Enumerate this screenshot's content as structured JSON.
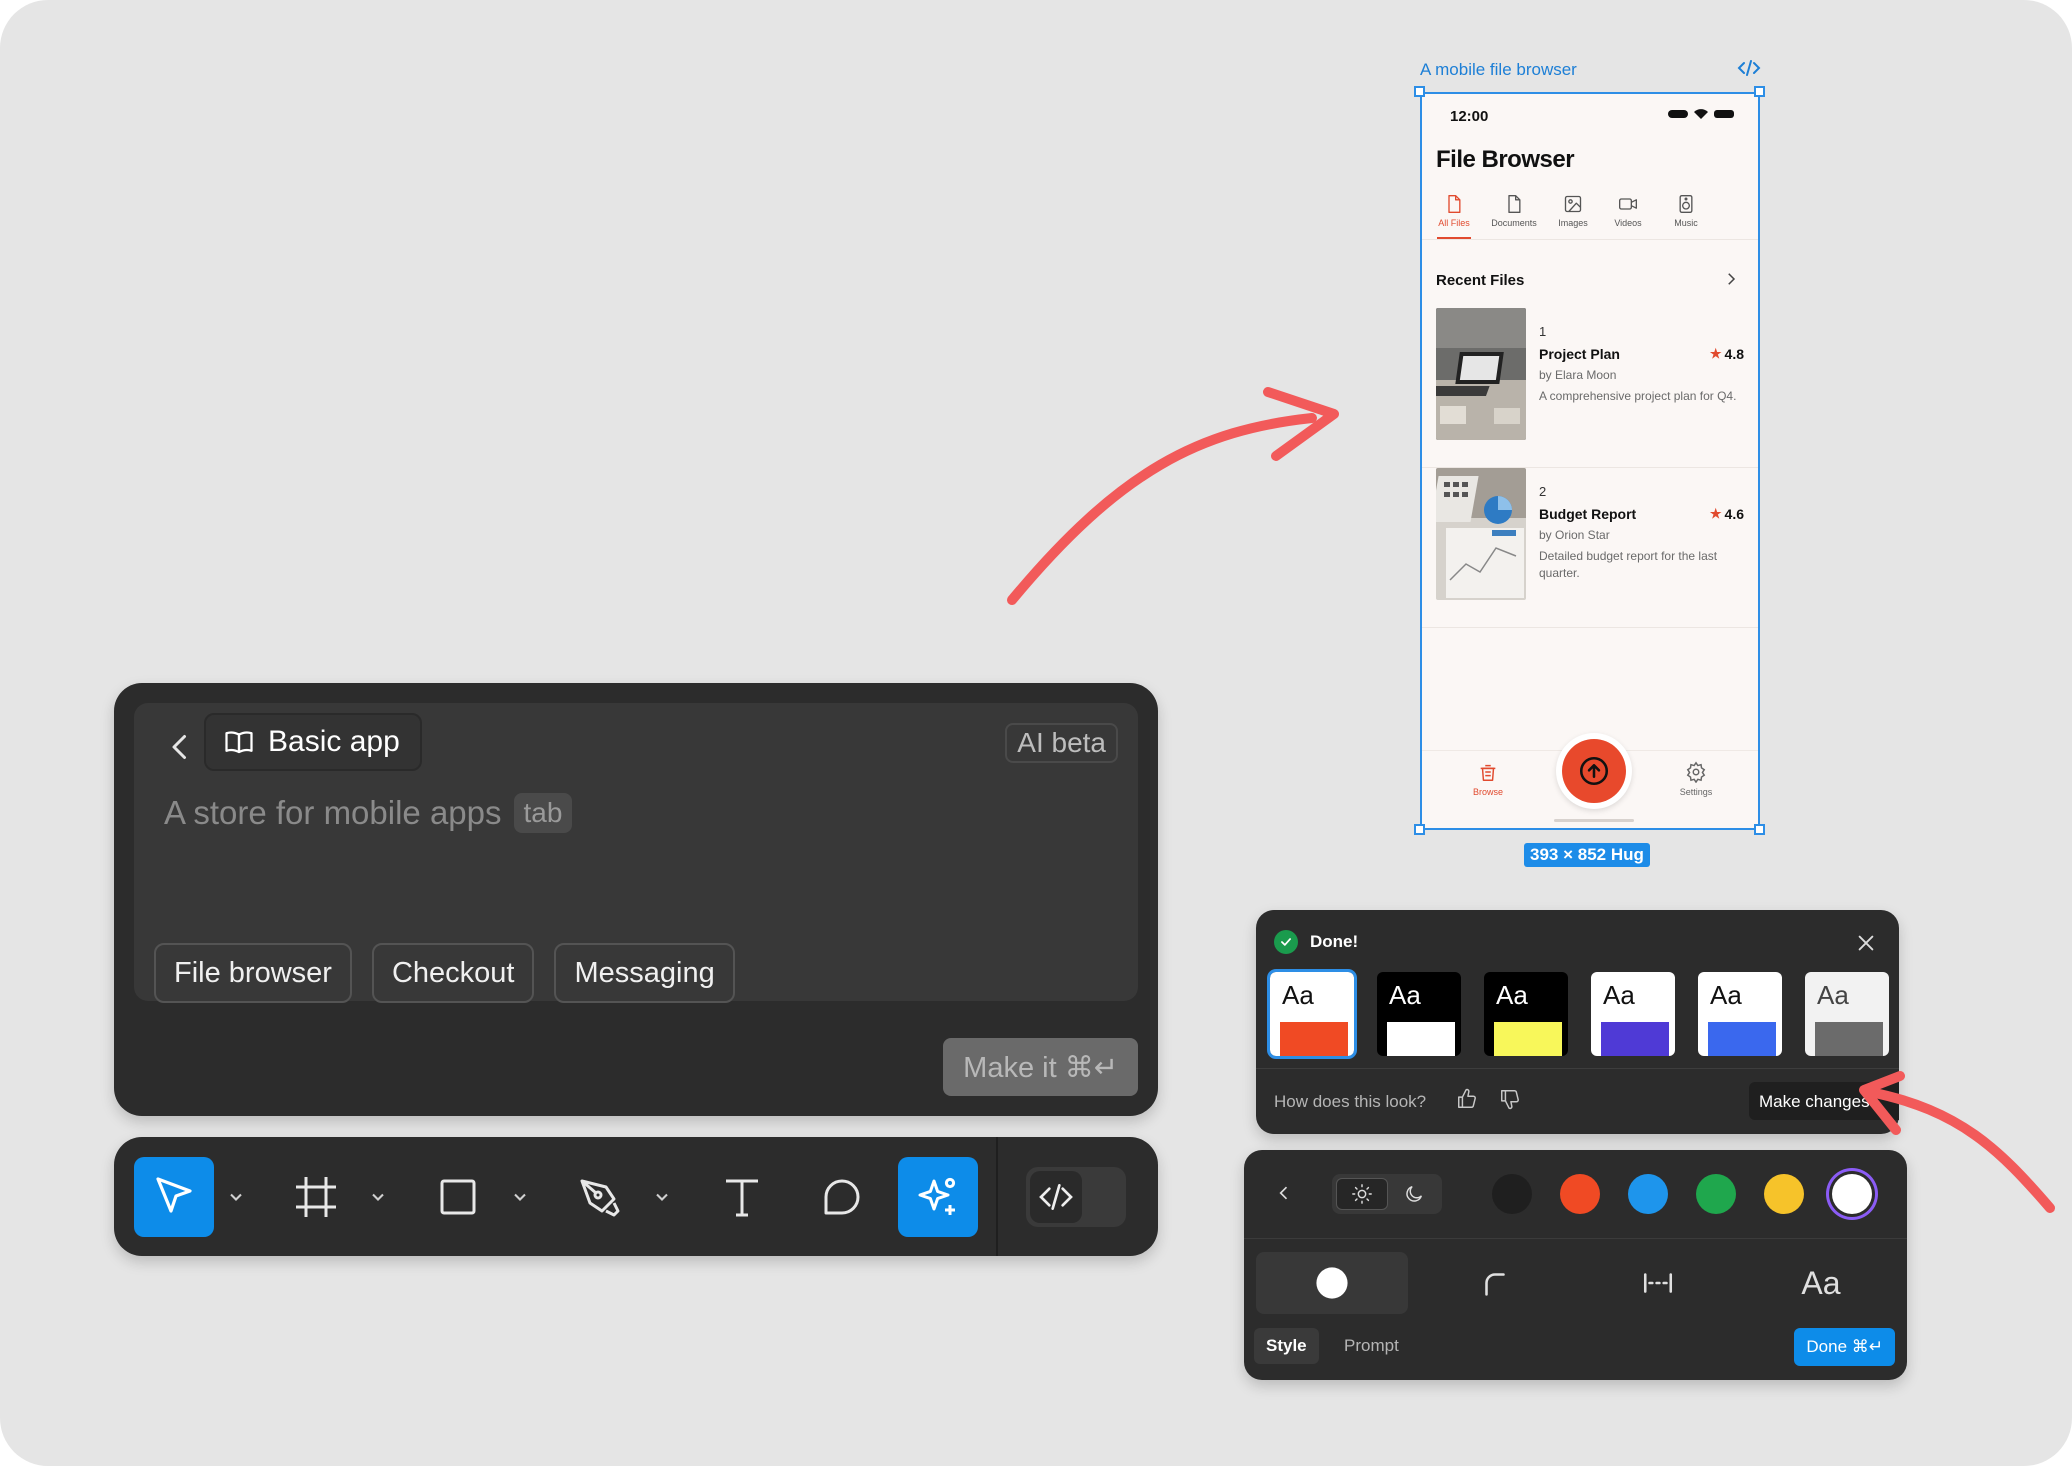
{
  "prompt_panel": {
    "template_label": "Basic app",
    "ai_badge": "AI beta",
    "placeholder": "A store for mobile apps",
    "tab_hint": "tab",
    "suggestions": [
      "File browser",
      "Checkout",
      "Messaging"
    ],
    "make_it_label": "Make it ⌘↵"
  },
  "toolbar": {
    "tools": [
      "move-tool",
      "frame-tool",
      "shape-tool",
      "pen-tool",
      "text-tool",
      "comment-tool",
      "ai-tool"
    ],
    "active_tools": [
      "move-tool",
      "ai-tool"
    ]
  },
  "frame": {
    "label": "A mobile file browser",
    "size_label": "393 × 852 Hug"
  },
  "app": {
    "time": "12:00",
    "title": "File Browser",
    "categories": [
      "All Files",
      "Documents",
      "Images",
      "Videos",
      "Music"
    ],
    "active_category": "All Files",
    "section_title": "Recent Files",
    "files": [
      {
        "num": "1",
        "name": "Project Plan",
        "rating": "4.8",
        "author": "by Elara Moon",
        "desc": "A comprehensive project plan for Q4."
      },
      {
        "num": "2",
        "name": "Budget Report",
        "rating": "4.6",
        "author": "by Orion Star",
        "desc": "Detailed budget report for the last quarter."
      }
    ],
    "nav": {
      "browse": "Browse",
      "settings": "Settings"
    },
    "accent": "#e8492c"
  },
  "theme_panel": {
    "status": "Done!",
    "aa": "Aa",
    "themes": [
      {
        "bg": "#ffffff",
        "text": "#111111",
        "band": "#f04a24"
      },
      {
        "bg": "#000000",
        "text": "#ffffff",
        "band": "#ffffff"
      },
      {
        "bg": "#000000",
        "text": "#ffffff",
        "band": "#f8f75a"
      },
      {
        "bg": "#ffffff",
        "text": "#111111",
        "band": "#4f3ad6"
      },
      {
        "bg": "#ffffff",
        "text": "#111111",
        "band": "#3a68ee"
      },
      {
        "bg": "#f2f2f2",
        "text": "#444444",
        "band": "#6b6b6b"
      }
    ],
    "feedback_question": "How does this look?",
    "make_changes": "Make changes"
  },
  "style_panel": {
    "colors": [
      "#1f1f1f",
      "#f04a24",
      "#1e95ec",
      "#1fa74d",
      "#f6c32a",
      "#ffffff"
    ],
    "selected_color": "#ffffff",
    "font_label": "Aa",
    "tabs": [
      "Style",
      "Prompt"
    ],
    "active_tab": "Style",
    "done_label": "Done ⌘↵"
  },
  "colors": {
    "accent_blue": "#0d8ce9",
    "arrow_red": "#f25a5a",
    "panel_dark": "#2c2c2c"
  }
}
